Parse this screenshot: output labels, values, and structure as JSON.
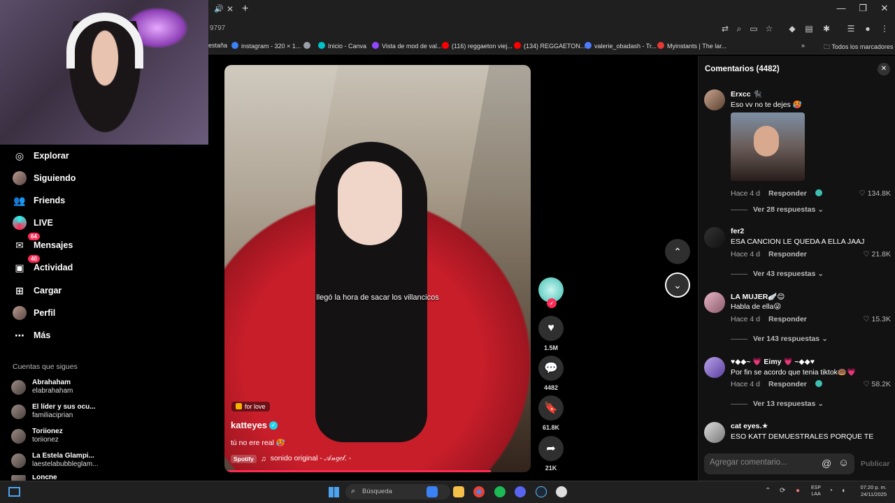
{
  "browser": {
    "url_fragment": "9797",
    "bookmarks": [
      {
        "label": "estaña",
        "color": "#1f1f1f"
      },
      {
        "label": "instagram - 320 × 1...",
        "color": "#3b82f6"
      },
      {
        "label": "",
        "color": "#9aa0a6"
      },
      {
        "label": "Inicio - Canva",
        "color": "#00c4cc"
      },
      {
        "label": "Vista de mod de val...",
        "color": "#9146ff"
      },
      {
        "label": "(116) reggaeton viej...",
        "color": "#ff0000"
      },
      {
        "label": "(134) REGGAETON...",
        "color": "#ff0000"
      },
      {
        "label": "valerie_obadash - Tr...",
        "color": "#4f7cff"
      },
      {
        "label": "Myinstants | The lar...",
        "color": "#e53935"
      }
    ],
    "bookmarks_overflow": "»",
    "all_bookmarks": "Todos los marcadores"
  },
  "sidebar": {
    "items": [
      {
        "label": "Explorar",
        "icon": "compass-icon",
        "glyph": "◎"
      },
      {
        "label": "Siguiendo",
        "icon": "following-avatar-icon",
        "glyph": ""
      },
      {
        "label": "Friends",
        "icon": "friends-icon",
        "glyph": "👥"
      },
      {
        "label": "LIVE",
        "icon": "live-icon",
        "glyph": ""
      },
      {
        "label": "Mensajes",
        "icon": "messages-icon",
        "glyph": "✉",
        "badge": "64"
      },
      {
        "label": "Actividad",
        "icon": "activity-icon",
        "glyph": "▣",
        "badge": "40"
      },
      {
        "label": "Cargar",
        "icon": "upload-icon",
        "glyph": "⊞"
      },
      {
        "label": "Perfil",
        "icon": "profile-avatar-icon",
        "glyph": ""
      },
      {
        "label": "Más",
        "icon": "more-icon",
        "glyph": "⋯"
      }
    ],
    "following_title": "Cuentas que sigues",
    "accounts": [
      {
        "name": "Abrahaham",
        "handle": "elabrahaham"
      },
      {
        "name": "El líder y sus ocu...",
        "handle": "familiaciprian"
      },
      {
        "name": "Toriionez",
        "handle": "toriionez"
      },
      {
        "name": "La Estela Glampi...",
        "handle": "laestelabubbleglam..."
      },
      {
        "name": "Lonche",
        "handle": ""
      }
    ]
  },
  "video": {
    "caption_overlay": "llegó la hora de sacar los villancicos",
    "tag": "for love",
    "author": "katteyes",
    "description": "tú no ere real 🥵",
    "spotify_label": "Spotify",
    "music_note": "♫",
    "music": "sonido original - 𝒜𝓃𝑔𝑒𝓁. -",
    "progress": 0.87
  },
  "actions": {
    "likes": "1.5M",
    "comments": "4482",
    "saves": "61.8K",
    "shares": "21K",
    "like_glyph": "♥",
    "comment_glyph": "💬",
    "save_glyph": "🔖",
    "share_glyph": "➦",
    "follow_glyph": "✓"
  },
  "nav": {
    "up_glyph": "⌃",
    "down_glyph": "⌄"
  },
  "comments": {
    "title": "Comentarios (4482)",
    "close_glyph": "✕",
    "items": [
      {
        "user": "Erxcc 🐈‍⬛",
        "text": "Eso vv no te dejes 🥵",
        "time": "Hace 4 d",
        "reply": "Responder",
        "likes": "♡ 134.8K",
        "replies": "Ver 28 respuestas ⌄"
      },
      {
        "user": "fer2",
        "text": "ESA CANCION LE QUEDA A ELLA JAAJ",
        "time": "Hace 4 d",
        "reply": "Responder",
        "likes": "♡ 21.8K",
        "replies": "Ver 43 respuestas ⌄"
      },
      {
        "user": "LA MUJER🪽😊",
        "text": "Habla de ella😜",
        "time": "Hace 4 d",
        "reply": "Responder",
        "likes": "♡ 15.3K",
        "replies": "Ver 143 respuestas ⌄"
      },
      {
        "user": "♥◆◆~ 💗 Eimy 💗 ~◆◆♥",
        "text": "Por fin se acordo que tenia tiktok🍩💗",
        "time": "Hace 4 d",
        "reply": "Responder",
        "likes": "♡ 58.2K",
        "replies": "Ver 13 respuestas ⌄"
      },
      {
        "user": "cat eyes.★",
        "text": "ESO KATT DEMUESTRALES PORQUE TE",
        "time": "",
        "reply": "",
        "likes": "",
        "replies": ""
      }
    ],
    "input_placeholder": "Agregar comentario...",
    "at_glyph": "@",
    "emoji_glyph": "☺",
    "post_label": "Publicar"
  },
  "taskbar": {
    "search_placeholder": "Búsqueda",
    "lang_1": "ESP",
    "lang_2": "LAA",
    "time": "07:20 p. m.",
    "date": "24/11/2025"
  }
}
